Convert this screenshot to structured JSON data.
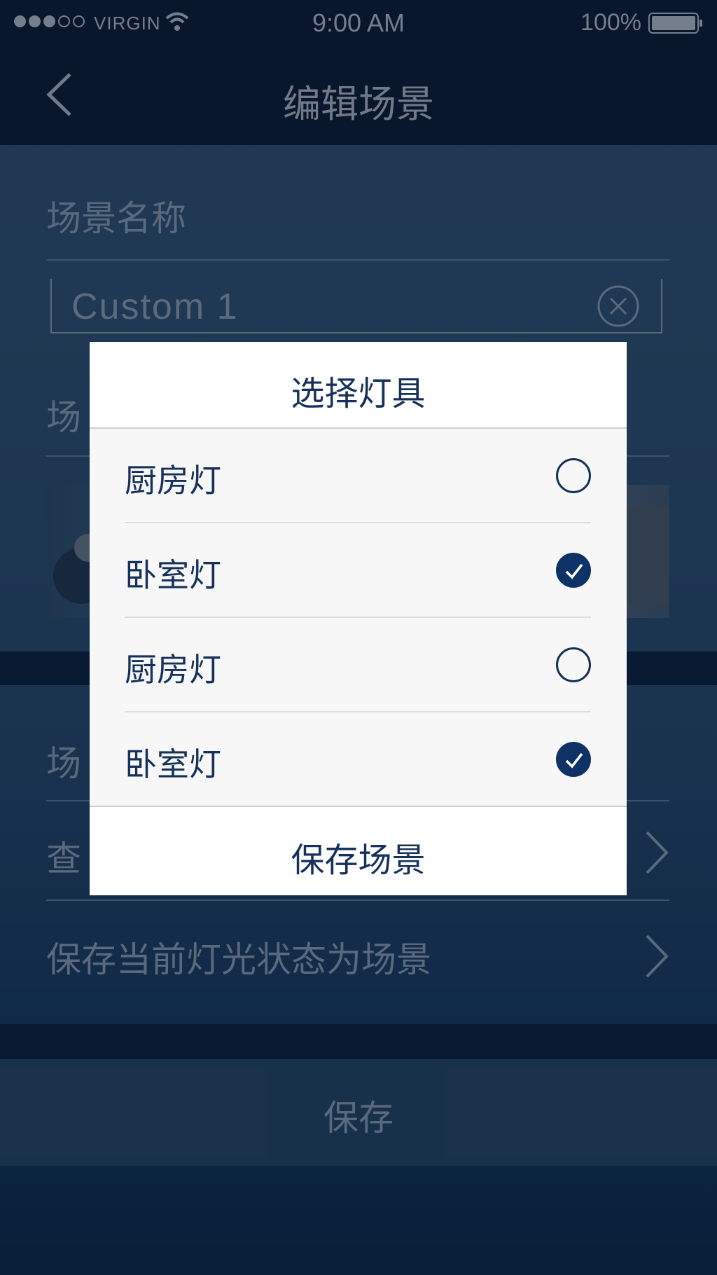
{
  "status_bar": {
    "signal_dots_filled": 3,
    "signal_dots_total": 5,
    "carrier": "VIRGIN",
    "time": "9:00 AM",
    "battery": "100%"
  },
  "nav": {
    "title": "编辑场景",
    "back_icon": "chevron-left-icon"
  },
  "form": {
    "scene_name_label": "场景名称",
    "scene_name_value": "Custom 1",
    "clear_icon": "circle-x-icon",
    "section2_label_visible": "场",
    "section3_label_visible": "场",
    "row_view_visible": "查",
    "save_current_row": "保存当前灯光状态为场景",
    "save_button": "保存"
  },
  "modal": {
    "title": "选择灯具",
    "items": [
      {
        "label": "厨房灯",
        "checked": false
      },
      {
        "label": "卧室灯",
        "checked": true
      },
      {
        "label": "厨房灯",
        "checked": false
      },
      {
        "label": "卧室灯",
        "checked": true
      }
    ],
    "save_label": "保存场景"
  },
  "colors": {
    "accent": "#0f3266",
    "text_dark": "#16325a",
    "background": "#24405e"
  }
}
